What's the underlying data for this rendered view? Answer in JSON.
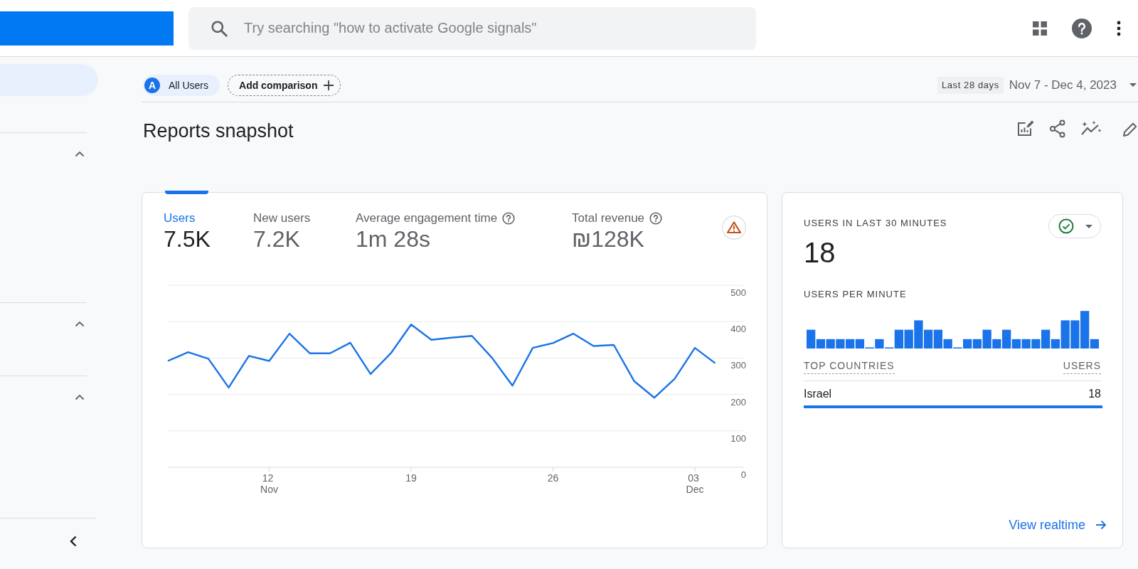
{
  "header": {
    "search": {
      "placeholder": "Try searching \"how to activate Google signals\""
    }
  },
  "sidebar": {
    "items": [
      {
        "selected": true
      }
    ],
    "sections": [
      {
        "expanded": true
      },
      {
        "expanded": true
      },
      {
        "expanded": true
      }
    ]
  },
  "filters": {
    "segments": [
      {
        "avatar": "A",
        "label": "All Users"
      }
    ],
    "add_comparison": "Add comparison",
    "date_range": {
      "preset": "Last 28 days",
      "range": "Nov 7 - Dec 4, 2023"
    }
  },
  "page_title": "Reports snapshot",
  "overview_card": {
    "metrics": [
      {
        "label": "Users",
        "value": "7.5K",
        "selected": true,
        "help": false
      },
      {
        "label": "New users",
        "value": "7.2K",
        "selected": false,
        "help": false
      },
      {
        "label": "Average engagement time",
        "value": "1m 28s",
        "selected": false,
        "help": true
      },
      {
        "label": "Total revenue",
        "value": "₪128K",
        "selected": false,
        "help": true
      }
    ],
    "chart_data": {
      "type": "line",
      "grid": true,
      "categories": [
        null,
        null,
        null,
        null,
        null,
        "12 Nov",
        null,
        null,
        null,
        null,
        null,
        null,
        "19",
        null,
        null,
        null,
        null,
        null,
        null,
        "26",
        null,
        null,
        null,
        null,
        null,
        null,
        "03 Dec",
        null
      ],
      "ylim": [
        0,
        500
      ],
      "yticks": [
        0,
        100,
        200,
        300,
        400,
        500
      ],
      "series": [
        {
          "color": "#1a73e8",
          "values": [
            292,
            316,
            298,
            219,
            306,
            292,
            367,
            313,
            313,
            342,
            256,
            313,
            392,
            350,
            356,
            361,
            300,
            224,
            328,
            341,
            367,
            333,
            336,
            237,
            191,
            243,
            328,
            286
          ]
        }
      ]
    }
  },
  "realtime_card": {
    "title": "USERS IN LAST 30 MINUTES",
    "value": "18",
    "per_minute_label": "USERS PER MINUTE",
    "table": {
      "columns": [
        "TOP COUNTRIES",
        "USERS"
      ],
      "rows": [
        {
          "country": "Israel",
          "users": "18",
          "level": 1
        }
      ]
    },
    "link": "View realtime"
  }
}
